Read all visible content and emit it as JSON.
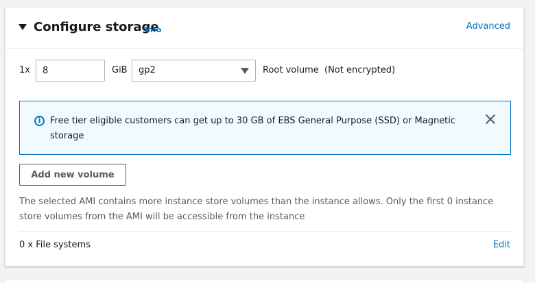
{
  "section": {
    "title": "Configure storage",
    "info_label": "Info",
    "advanced_label": "Advanced"
  },
  "volume": {
    "count_label": "1x",
    "size_value": "8",
    "unit_label": "GiB",
    "type_value": "gp2",
    "description": "Root volume  (Not encrypted)"
  },
  "alert": {
    "text": "Free tier eligible customers can get up to 30 GB of EBS General Purpose (SSD) or Magnetic storage",
    "icon": "info-circle-icon"
  },
  "add_volume_label": "Add new volume",
  "note": "The selected AMI contains more instance store volumes than the instance allows. Only the first 0 instance store volumes from the AMI will be accessible from the instance",
  "file_systems": {
    "label": "0 x File systems",
    "edit_label": "Edit"
  },
  "colors": {
    "link": "#0073bb",
    "alert_bg": "#f1faff",
    "alert_border": "#0073bb",
    "text": "#16191f",
    "muted": "#545b64"
  }
}
